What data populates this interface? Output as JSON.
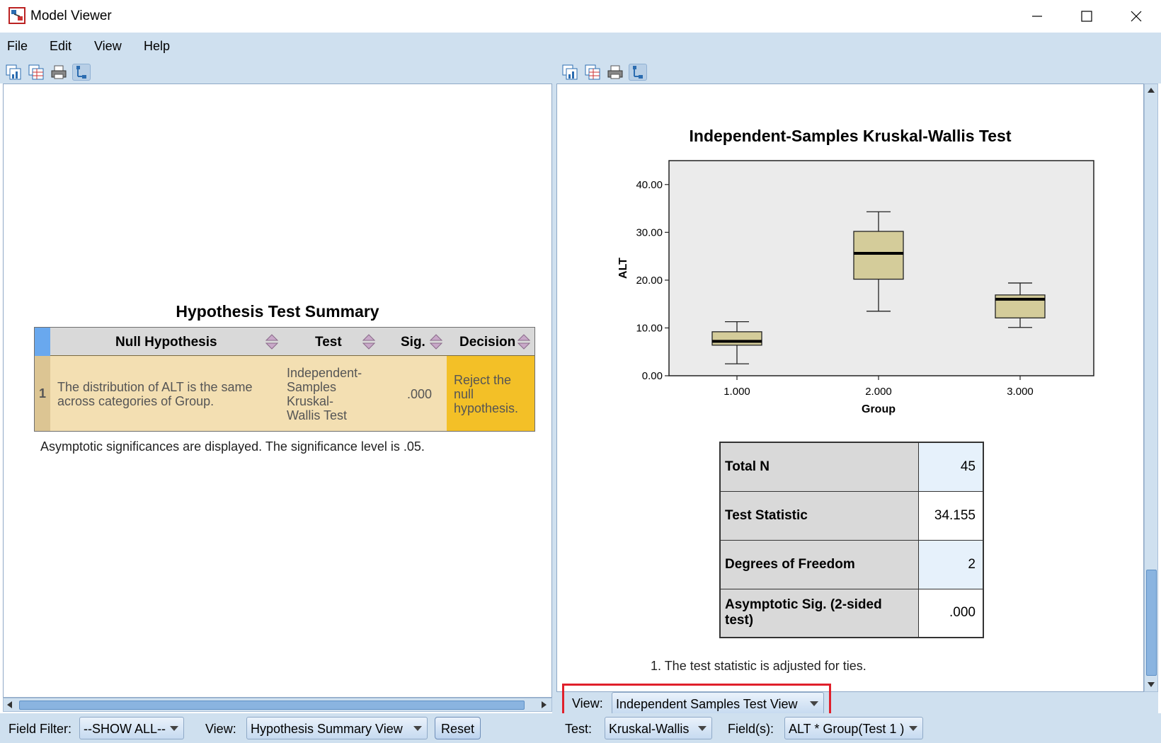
{
  "window": {
    "title": "Model Viewer",
    "icon": "model-viewer-app-icon",
    "controls": [
      "minimize-icon",
      "maximize-icon",
      "close-icon"
    ]
  },
  "menu": {
    "file": "File",
    "edit": "Edit",
    "view": "View",
    "help": "Help"
  },
  "toolbar_icons": [
    "copy-chart-icon",
    "copy-table-icon",
    "print-icon",
    "tree-icon"
  ],
  "left": {
    "title": "Hypothesis Test Summary",
    "headers": {
      "null_hypothesis": "Null Hypothesis",
      "test": "Test",
      "sig": "Sig.",
      "decision": "Decision"
    },
    "row": {
      "num": "1",
      "hypothesis_line1": "The distribution of ALT is the same",
      "hypothesis_line2": "across categories of Group.",
      "test_line1": "Independent-",
      "test_line2": "Samples",
      "test_line3": "Kruskal-",
      "test_line4": "Wallis Test",
      "sig": ".000",
      "decision_line1": "Reject the",
      "decision_line2": "null",
      "decision_line3": "hypothesis."
    },
    "footnote": "Asymptotic significances are displayed.  The significance level is .05."
  },
  "left_bottom": {
    "field_filter_label": "Field Filter:",
    "field_filter_value": "--SHOW ALL--",
    "view_label": "View:",
    "view_value": "Hypothesis Summary View",
    "reset_label": "Reset"
  },
  "right": {
    "chart_title": "Independent-Samples Kruskal-Wallis Test",
    "stats": {
      "total_n_label": "Total N",
      "total_n_value": "45",
      "test_stat_label": "Test Statistic",
      "test_stat_value": "34.155",
      "df_label": "Degrees of Freedom",
      "df_value": "2",
      "sig_label": "Asymptotic Sig. (2-sided test)",
      "sig_value": ".000"
    },
    "note": "1.  The test statistic is adjusted for ties."
  },
  "right_bottom": {
    "view_label": "View:",
    "view_value": "Independent Samples Test View",
    "test_label": "Test:",
    "test_value": "Kruskal-Wallis",
    "fields_label": "Field(s):",
    "fields_value": "ALT * Group(Test 1 )"
  },
  "colors": {
    "chrome": "#cfe0ef",
    "decision_highlight": "#f3c027",
    "row_fill": "#f3dfb2",
    "box_fill": "#d4cc9a",
    "plot_bg": "#ebebeb",
    "highlight_box": "#e0202b"
  },
  "chart_data": {
    "type": "boxplot",
    "xlabel": "Group",
    "ylabel": "ALT",
    "ylim": [
      0,
      45
    ],
    "yticks": [
      "0.00",
      "10.00",
      "20.00",
      "30.00",
      "40.00"
    ],
    "categories": [
      "1.000",
      "2.000",
      "3.000"
    ],
    "boxes": [
      {
        "min": 2.5,
        "q1": 6.4,
        "median": 7.2,
        "q3": 9.2,
        "max": 11.3
      },
      {
        "min": 13.5,
        "q1": 20.2,
        "median": 25.6,
        "q3": 30.2,
        "max": 34.3
      },
      {
        "min": 10.1,
        "q1": 12.1,
        "median": 16.0,
        "q3": 16.9,
        "max": 19.4
      }
    ]
  }
}
